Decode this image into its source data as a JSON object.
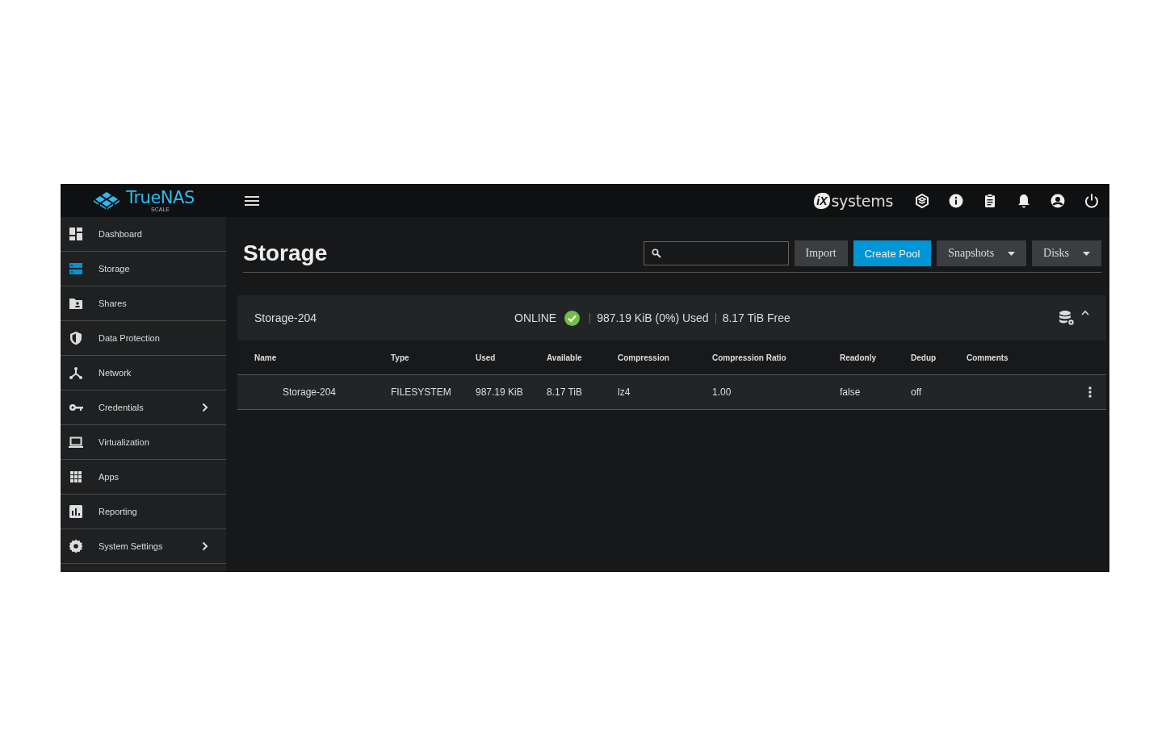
{
  "topbar": {
    "logo": {
      "name": "TrueNAS",
      "edition": "SCALE"
    },
    "brand": {
      "mark": "iX",
      "name": "systems"
    }
  },
  "sidebar": {
    "items": [
      {
        "label": "Dashboard",
        "kind": "dashboard",
        "selected": false,
        "expandable": false
      },
      {
        "label": "Storage",
        "kind": "storage",
        "selected": true,
        "expandable": false
      },
      {
        "label": "Shares",
        "kind": "shares",
        "selected": false,
        "expandable": false
      },
      {
        "label": "Data Protection",
        "kind": "shield",
        "selected": false,
        "expandable": false
      },
      {
        "label": "Network",
        "kind": "network",
        "selected": false,
        "expandable": false
      },
      {
        "label": "Credentials",
        "kind": "key",
        "selected": false,
        "expandable": true
      },
      {
        "label": "Virtualization",
        "kind": "laptop",
        "selected": false,
        "expandable": false
      },
      {
        "label": "Apps",
        "kind": "apps",
        "selected": false,
        "expandable": false
      },
      {
        "label": "Reporting",
        "kind": "chart",
        "selected": false,
        "expandable": false
      },
      {
        "label": "System Settings",
        "kind": "gear",
        "selected": false,
        "expandable": true
      }
    ]
  },
  "page": {
    "title": "Storage",
    "buttons": [
      {
        "label": "Import",
        "kind": "default",
        "dropdown": false
      },
      {
        "label": "Create Pool",
        "kind": "primary",
        "dropdown": false
      },
      {
        "label": "Snapshots",
        "kind": "default",
        "dropdown": true
      },
      {
        "label": "Disks",
        "kind": "default",
        "dropdown": true
      }
    ]
  },
  "pool": {
    "name": "Storage-204",
    "status": "ONLINE",
    "healthy": true,
    "used": "987.19 KiB (0%) Used",
    "free": "8.17 TiB Free",
    "expanded": true,
    "table": {
      "columns": [
        "Name",
        "Type",
        "Used",
        "Available",
        "Compression",
        "Compression Ratio",
        "Readonly",
        "Dedup",
        "Comments"
      ],
      "rows": [
        [
          "Storage-204",
          "FILESYSTEM",
          "987.19 KiB",
          "8.17 TiB",
          "lz4",
          "1.00",
          "false",
          "off",
          null
        ]
      ]
    }
  }
}
